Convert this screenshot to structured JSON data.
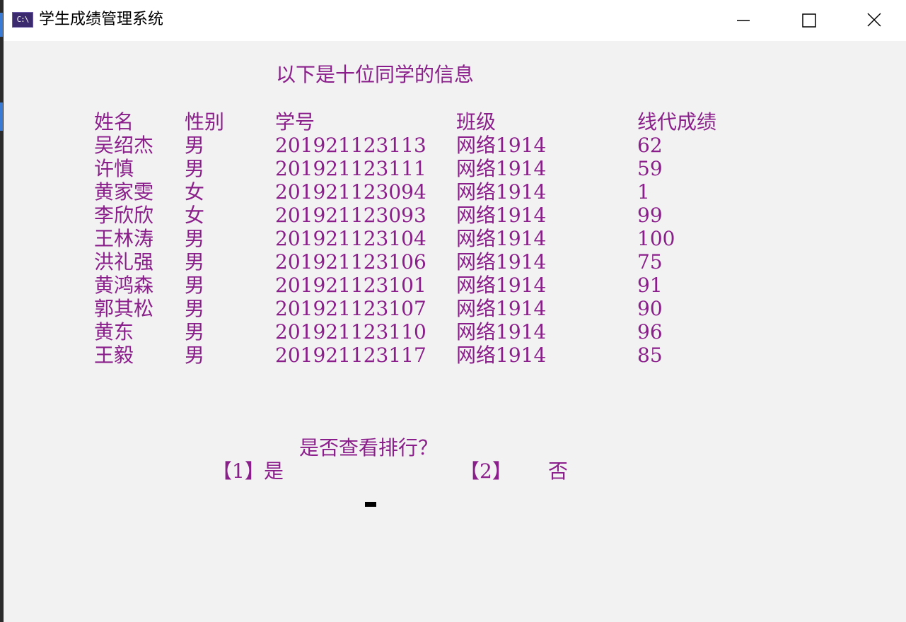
{
  "window": {
    "title": "学生成绩管理系统",
    "icon": "C:\\"
  },
  "console": {
    "heading": "以下是十位同学的信息",
    "columns": [
      "姓名",
      "性别",
      "学号",
      "班级",
      "线代成绩"
    ],
    "rows": [
      [
        "吴绍杰",
        "男",
        "201921123113",
        "网络1914",
        "62"
      ],
      [
        "许慎",
        "男",
        "201921123111",
        "网络1914",
        "59"
      ],
      [
        "黄家雯",
        "女",
        "201921123094",
        "网络1914",
        "1"
      ],
      [
        "李欣欣",
        "女",
        "201921123093",
        "网络1914",
        "99"
      ],
      [
        "王林涛",
        "男",
        "201921123104",
        "网络1914",
        "100"
      ],
      [
        "洪礼强",
        "男",
        "201921123106",
        "网络1914",
        "75"
      ],
      [
        "黄鸿森",
        "男",
        "201921123101",
        "网络1914",
        "91"
      ],
      [
        "郭其松",
        "男",
        "201921123107",
        "网络1914",
        "90"
      ],
      [
        "黄东",
        "男",
        "201921123110",
        "网络1914",
        "96"
      ],
      [
        "王毅",
        "男",
        "201921123117",
        "网络1914",
        "85"
      ]
    ],
    "prompt": "是否查看排行？",
    "option1_key": "【1】",
    "option1_label": "是",
    "option2_key": "【2】",
    "option2_label": "否"
  },
  "colors": {
    "console_text": "#8a1e8a",
    "console_bg": "#f2f2f2",
    "titlebar_bg": "#ffffff"
  }
}
